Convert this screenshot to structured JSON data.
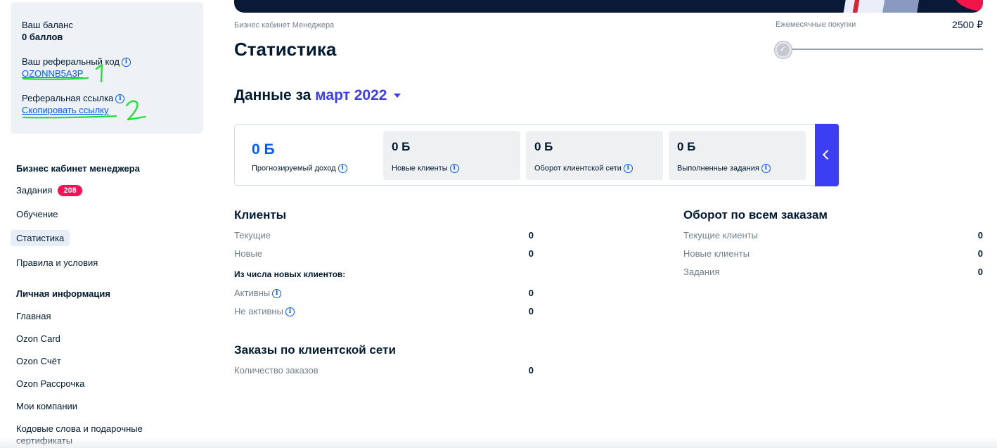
{
  "sidebar": {
    "balance_label": "Ваш баланс",
    "balance_value": "0 баллов",
    "ref_code_label": "Ваш реферальный код",
    "ref_code_value": "OZONNB5A3P",
    "ref_link_label": "Реферальная ссылка",
    "ref_link_action": "Скопировать ссылку",
    "annotation_1": "1",
    "annotation_2": "2",
    "section1_title": "Бизнес кабинет менеджера",
    "section1_items": [
      {
        "label": "Задания",
        "badge": "208"
      },
      {
        "label": "Обучение"
      },
      {
        "label": "Статистика",
        "active": true
      },
      {
        "label": "Правила и условия"
      }
    ],
    "section2_title": "Личная информация",
    "section2_items": [
      {
        "label": "Главная"
      },
      {
        "label": "Ozon Card"
      },
      {
        "label": "Ozon Счёт"
      },
      {
        "label": "Ozon Рассрочка"
      },
      {
        "label": "Мои компании"
      },
      {
        "label": "Кодовые слова и подарочные сертификаты"
      }
    ]
  },
  "header": {
    "breadcrumb": "Бизнес кабинет Менеджера",
    "title": "Статистика",
    "monthly_label": "Ежемесячные покупки",
    "monthly_value": "2500 ₽",
    "monthly_progress": 0
  },
  "period": {
    "prefix": "Данные за",
    "month": "март 2022"
  },
  "stats": [
    {
      "value": "0 Б",
      "label": "Прогнозируемый доход"
    },
    {
      "value": "0 Б",
      "label": "Новые клиенты"
    },
    {
      "value": "0 Б",
      "label": "Оборот клиентской сети"
    },
    {
      "value": "0 Б",
      "label": "Выполненные задания"
    }
  ],
  "clients": {
    "title": "Клиенты",
    "current_label": "Текущие",
    "current_value": "0",
    "new_label": "Новые",
    "new_value": "0",
    "subhead": "Из числа новых клиентов:",
    "active_label": "Активны",
    "active_value": "0",
    "inactive_label": "Не активны",
    "inactive_value": "0"
  },
  "orders": {
    "title": "Заказы по клиентской сети",
    "count_label": "Количество заказов",
    "count_value": "0"
  },
  "turnover": {
    "title": "Оборот по всем заказам",
    "current_label": "Текущие клиенты",
    "current_value": "0",
    "new_label": "Новые клиенты",
    "new_value": "0",
    "tasks_label": "Задания",
    "tasks_value": "0"
  },
  "colors": {
    "accent_blue": "#005bff",
    "period_blue": "#3b3ef2",
    "badge_red": "#f91155",
    "annotation_green": "#22e03a"
  }
}
